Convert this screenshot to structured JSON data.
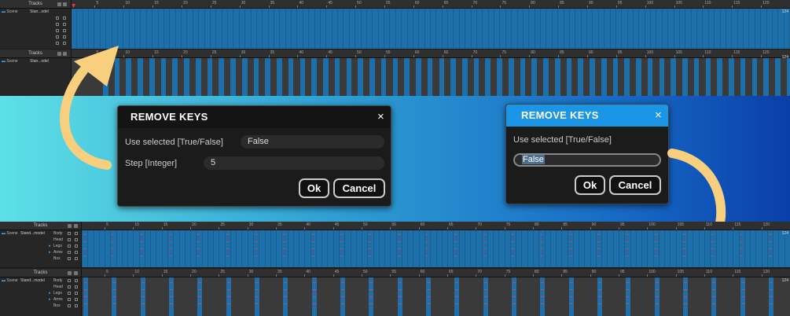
{
  "panels": [
    {
      "tracks_label": "Tracks",
      "scene_label": "Scene",
      "object_label": "Stan...odel",
      "sub_tracks": [
        "",
        "",
        "",
        "",
        ""
      ],
      "end_frame": "124"
    },
    {
      "tracks_label": "Tracks",
      "scene_label": "Scene",
      "object_label": "Stan...odel",
      "sub_tracks": [],
      "end_frame": "124"
    },
    {
      "tracks_label": "Tracks",
      "scene_label": "Scene",
      "object_label": "Stand...model",
      "sub_tracks": [
        "Body",
        "Head",
        "Legs",
        "Arms",
        "Box"
      ],
      "end_frame": "124"
    },
    {
      "tracks_label": "Tracks",
      "scene_label": "Scene",
      "object_label": "Stand...model",
      "sub_tracks": [
        "Body",
        "Head",
        "Legs",
        "Arms",
        "Box"
      ],
      "end_frame": "124"
    }
  ],
  "ruler_ticks": [
    "5",
    "10",
    "15",
    "20",
    "25",
    "30",
    "35",
    "40",
    "45",
    "50",
    "55",
    "60",
    "65",
    "70",
    "75",
    "80",
    "85",
    "90",
    "95",
    "100",
    "105",
    "110",
    "115",
    "120"
  ],
  "dialog_left": {
    "title": "REMOVE KEYS",
    "close_icon": "×",
    "field1_label": "Use selected [True/False]",
    "field1_value": "False",
    "field2_label": "Step [Integer]",
    "field2_value": "5",
    "ok_label": "Ok",
    "cancel_label": "Cancel"
  },
  "dialog_right": {
    "title": "REMOVE KEYS",
    "close_icon": "×",
    "field1_label": "Use selected [True/False]",
    "field1_value": "False",
    "ok_label": "Ok",
    "cancel_label": "Cancel"
  },
  "colors": {
    "key_blue": "#1c6fa8",
    "key_blue_dark": "#175e91",
    "title_blue": "#1b95e6",
    "arrow": "#f8cf7d",
    "key_red": "#e04040"
  }
}
